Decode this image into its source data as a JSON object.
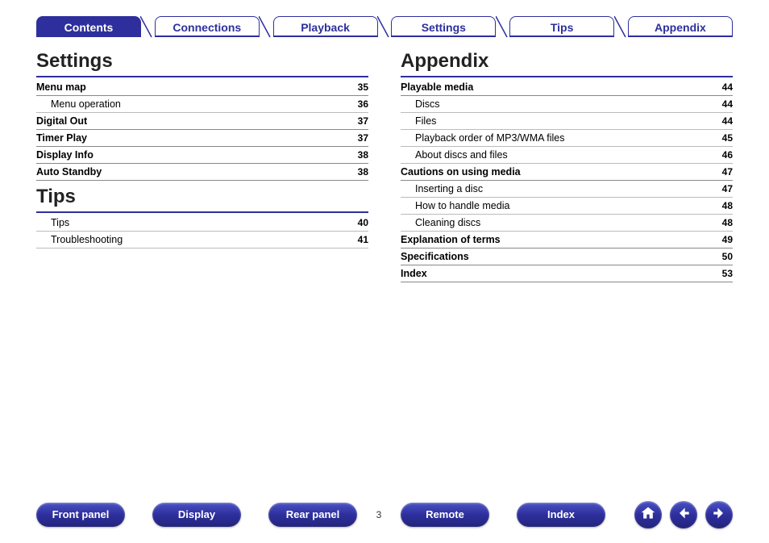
{
  "tabs": [
    {
      "label": "Contents",
      "active": true
    },
    {
      "label": "Connections",
      "active": false
    },
    {
      "label": "Playback",
      "active": false
    },
    {
      "label": "Settings",
      "active": false
    },
    {
      "label": "Tips",
      "active": false
    },
    {
      "label": "Appendix",
      "active": false
    }
  ],
  "left_sections": [
    {
      "title": "Settings",
      "rows": [
        {
          "label": "Menu map",
          "page": "35",
          "bold": true,
          "indent": 0
        },
        {
          "label": "Menu operation",
          "page": "36",
          "bold": false,
          "indent": 1
        },
        {
          "label": "Digital Out",
          "page": "37",
          "bold": true,
          "indent": 0
        },
        {
          "label": "Timer Play",
          "page": "37",
          "bold": true,
          "indent": 0
        },
        {
          "label": "Display Info",
          "page": "38",
          "bold": true,
          "indent": 0
        },
        {
          "label": "Auto Standby",
          "page": "38",
          "bold": true,
          "indent": 0
        }
      ]
    },
    {
      "title": "Tips",
      "rows": [
        {
          "label": "Tips",
          "page": "40",
          "bold": false,
          "indent": 1
        },
        {
          "label": "Troubleshooting",
          "page": "41",
          "bold": false,
          "indent": 1
        }
      ]
    }
  ],
  "right_sections": [
    {
      "title": "Appendix",
      "rows": [
        {
          "label": "Playable media",
          "page": "44",
          "bold": true,
          "indent": 0
        },
        {
          "label": "Discs",
          "page": "44",
          "bold": false,
          "indent": 1
        },
        {
          "label": "Files",
          "page": "44",
          "bold": false,
          "indent": 1
        },
        {
          "label": "Playback order of MP3/WMA files",
          "page": "45",
          "bold": false,
          "indent": 1
        },
        {
          "label": "About discs and files",
          "page": "46",
          "bold": false,
          "indent": 1
        },
        {
          "label": "Cautions on using media",
          "page": "47",
          "bold": true,
          "indent": 0
        },
        {
          "label": "Inserting a disc",
          "page": "47",
          "bold": false,
          "indent": 1
        },
        {
          "label": "How to handle media",
          "page": "48",
          "bold": false,
          "indent": 1
        },
        {
          "label": "Cleaning discs",
          "page": "48",
          "bold": false,
          "indent": 1
        },
        {
          "label": "Explanation of terms",
          "page": "49",
          "bold": true,
          "indent": 0
        },
        {
          "label": "Specifications",
          "page": "50",
          "bold": true,
          "indent": 0
        },
        {
          "label": "Index",
          "page": "53",
          "bold": true,
          "indent": 0
        }
      ]
    }
  ],
  "page_number": "3",
  "bottom_buttons_left": [
    "Front panel",
    "Display",
    "Rear panel"
  ],
  "bottom_buttons_right": [
    "Remote",
    "Index"
  ]
}
